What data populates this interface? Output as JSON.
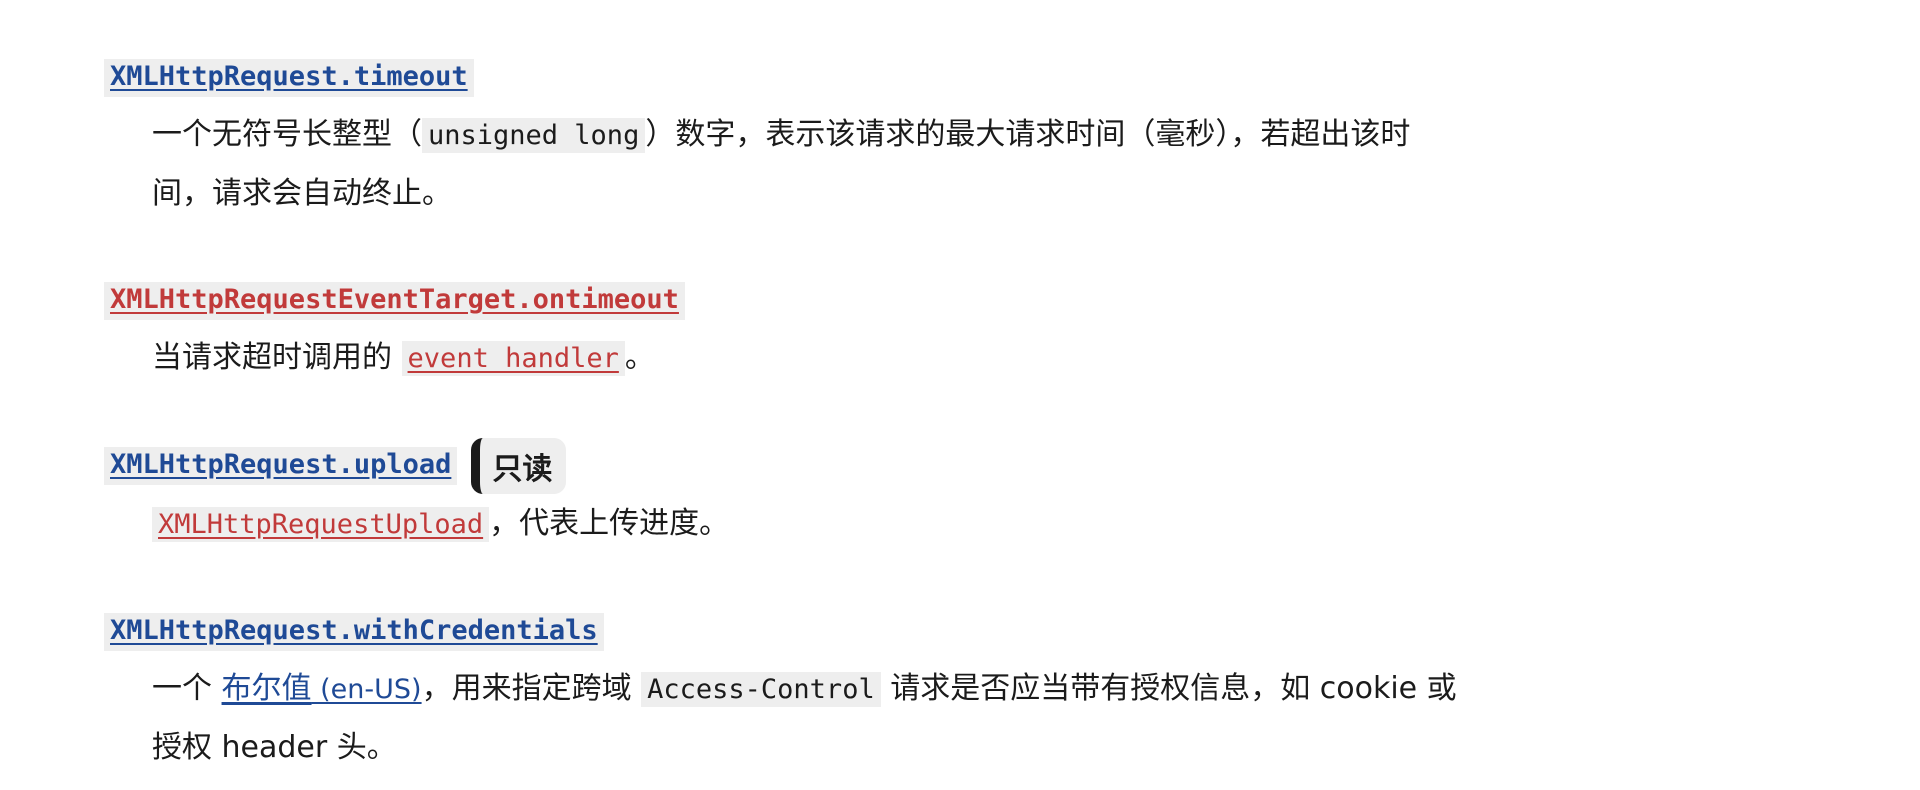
{
  "entries": [
    {
      "term": "XMLHttpRequest.timeout",
      "desc": {
        "part1": "一个无符号长整型（",
        "code": "unsigned long",
        "part2": "）数字，表示该请求的最大请求时间（毫秒），若超出该时",
        "part3": "间，请求会自动终止。"
      }
    },
    {
      "term": "XMLHttpRequestEventTarget.ontimeout",
      "desc": {
        "part1": "当请求超时调用的 ",
        "code_link": "event handler",
        "part2": "。"
      }
    },
    {
      "term": "XMLHttpRequest.upload",
      "badge": "只读",
      "desc": {
        "code_link": "XMLHttpRequestUpload",
        "part1": "，代表上传进度。"
      }
    },
    {
      "term": "XMLHttpRequest.withCredentials",
      "desc": {
        "part1": "一个 ",
        "link": "布尔值",
        "link_suffix": " (en-US)",
        "part2": "，用来指定跨域 ",
        "code": "Access-Control",
        "part3": " 请求是否应当带有授权信息，如 cookie 或",
        "part4": "授权 header 头。"
      }
    }
  ],
  "colors": {
    "link_blue": "#1f4a96",
    "link_red_missing": "#c13a3a",
    "code_bg": "#eeeeee",
    "text": "#1b1b1b"
  }
}
